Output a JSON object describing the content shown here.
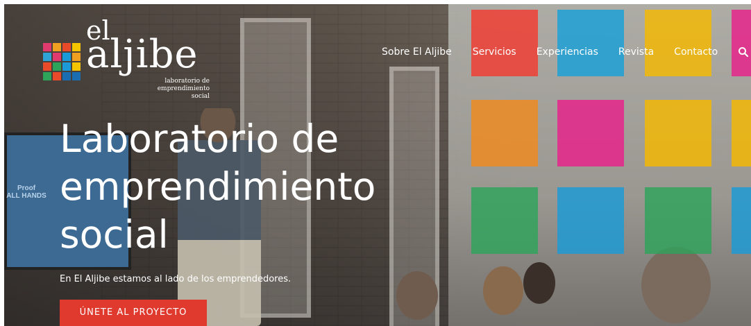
{
  "brand": {
    "logo_small": "el",
    "logo_main": "aljibe",
    "logo_tagline_1": "laboratorio de",
    "logo_tagline_2": "emprendimiento",
    "logo_tagline_3": "social",
    "grid_colors": [
      "#e03a6f",
      "#f0a020",
      "#e84a2a",
      "#f5c400",
      "#2ea3d8",
      "#e03a6f",
      "#1a9bd7",
      "#f0a020",
      "#e84a2a",
      "#2ea35a",
      "#1a9bd7",
      "#f5c400",
      "#2ea35a",
      "#e84a2a",
      "#1a6db0",
      "#1a6db0"
    ]
  },
  "nav": {
    "items": [
      "Sobre El Aljibe",
      "Servicios",
      "Experiencias",
      "Revista",
      "Contacto"
    ],
    "search_icon": "search-icon"
  },
  "hero": {
    "title_line_1": "Laboratorio de",
    "title_line_2": "emprendimiento",
    "title_line_3": "social",
    "subtitle": "En El Aljibe estamos al lado de los emprendedores.",
    "cta_label": "ÚNETE AL PROYECTO"
  },
  "background": {
    "screen_text_1": "Proof",
    "screen_text_2": "ALL HANDS",
    "tile_colors": [
      "#f23b2f",
      "#19a0d8",
      "#f5b800",
      "#f08a1e",
      "#e8208a",
      "#f5b800",
      "#2ea35a",
      "#1a9bd7",
      "#2ea35a"
    ]
  },
  "colors": {
    "accent": "#e03a2f",
    "text": "#ffffff"
  }
}
